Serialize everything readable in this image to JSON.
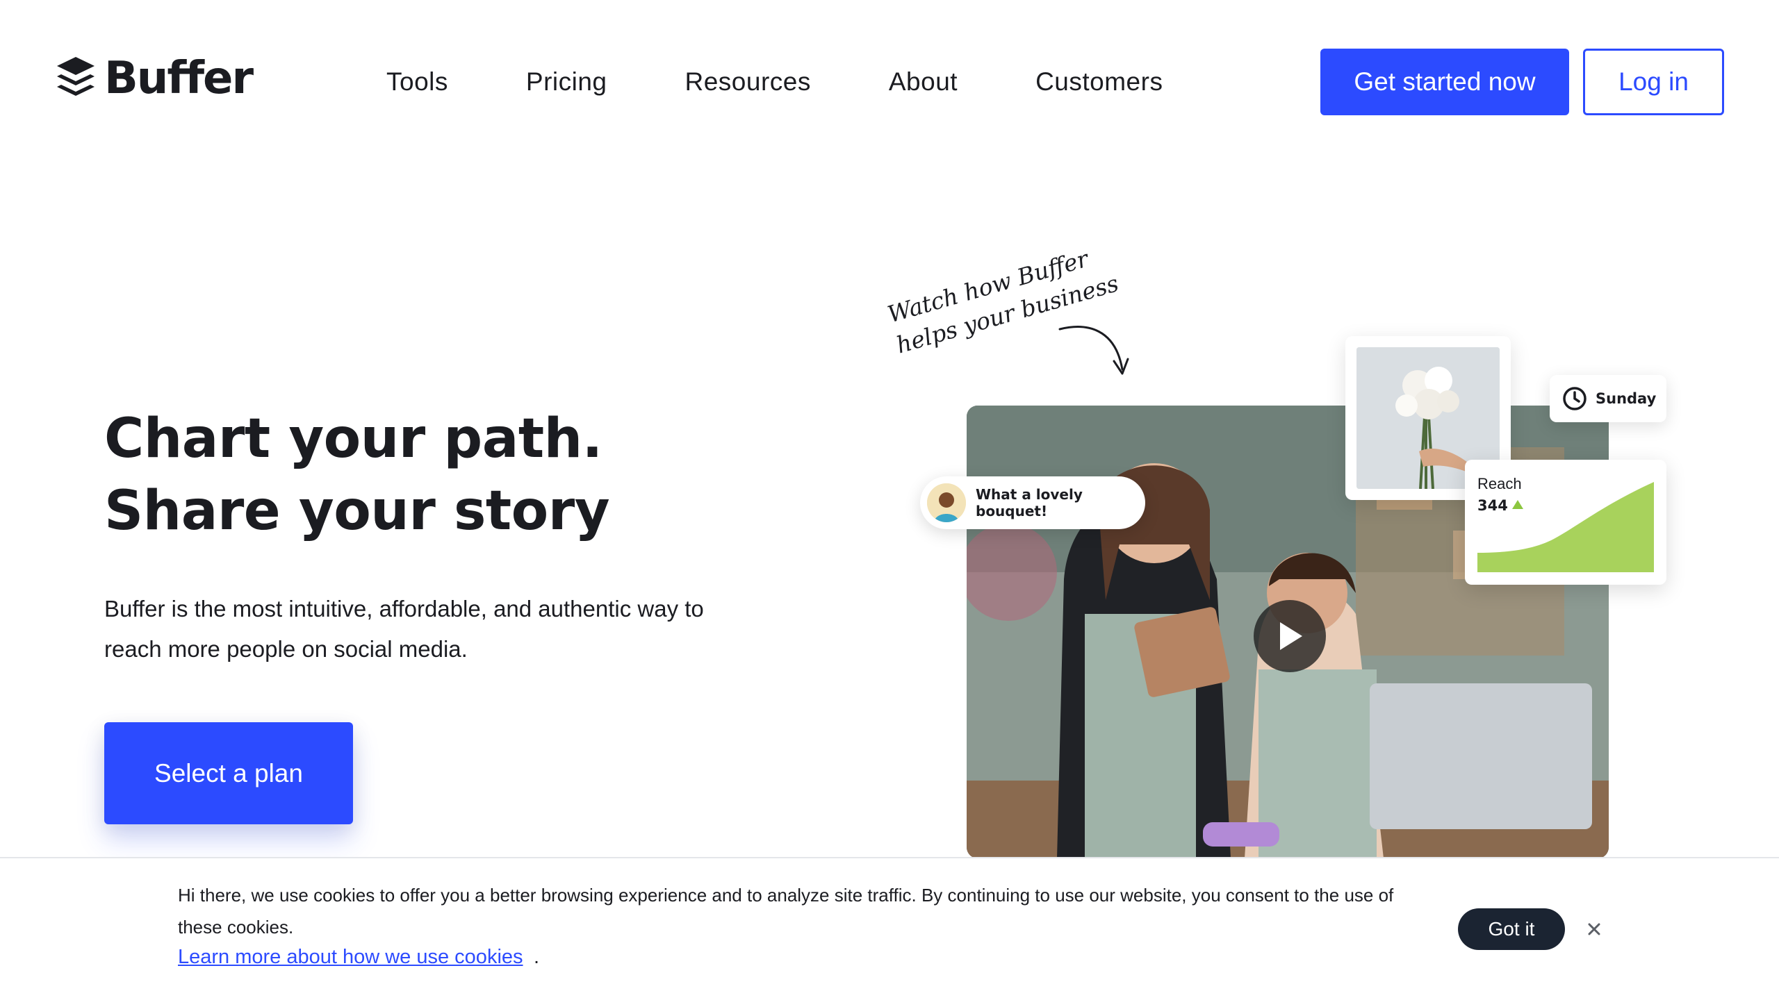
{
  "brand": {
    "name": "Buffer",
    "accent": "#2c4bff"
  },
  "nav": {
    "items": [
      {
        "label": "Tools"
      },
      {
        "label": "Pricing"
      },
      {
        "label": "Resources"
      },
      {
        "label": "About"
      },
      {
        "label": "Customers"
      }
    ],
    "get_started_label": "Get started now",
    "login_label": "Log in"
  },
  "hero": {
    "title_line1": "Chart your path.",
    "title_line2": "Share your story",
    "description": "Buffer is the most intuitive, affordable, and authentic way to reach more people on social media.",
    "cta_label": "Select a plan"
  },
  "media": {
    "handwritten_note": "Watch how Buffer\nhelps your business",
    "comment_text": "What a lovely bouquet!",
    "day_label": "Sunday",
    "reach_label": "Reach",
    "reach_value": "344",
    "reach_trend": "up",
    "reach_color": "#a8d25c",
    "icons": [
      "clock-icon",
      "play-icon",
      "arrow-icon",
      "close-icon"
    ]
  },
  "cookie": {
    "text": "Hi there, we use cookies to offer you a better browsing experience and to analyze site traffic. By continuing to use our website, you consent to the use of these cookies.",
    "link_label": "Learn more about how we use cookies",
    "link_suffix": ".",
    "accept_label": "Got it"
  }
}
